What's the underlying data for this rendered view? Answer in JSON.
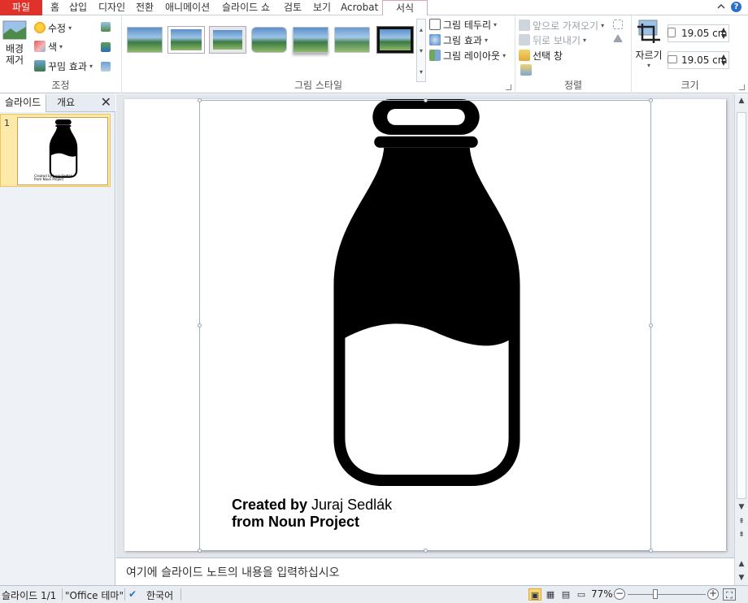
{
  "tabs": {
    "file": "파일",
    "home": "홈",
    "insert": "삽입",
    "design": "디자인",
    "transitions": "전환",
    "animations": "애니메이션",
    "slideshow": "슬라이드 쇼",
    "review": "검토",
    "view": "보기",
    "acrobat": "Acrobat",
    "format": "서식"
  },
  "ribbon": {
    "adjust": {
      "remove_bg_line1": "배경",
      "remove_bg_line2": "제거",
      "corrections": "수정",
      "color": "색",
      "artistic_effects": "꾸밈 효과",
      "label": "조정"
    },
    "picture_styles": {
      "border": "그림 테두리",
      "effects": "그림 효과",
      "layout": "그림 레이아웃",
      "label": "그림 스타일",
      "style_count": 7,
      "selected_style_index": 6
    },
    "arrange": {
      "bring_forward": "앞으로 가져오기",
      "send_backward": "뒤로 보내기",
      "selection_pane": "선택 창",
      "label": "정렬"
    },
    "size": {
      "crop": "자르기",
      "height": "19.05 cm",
      "width": "19.05 cm",
      "label": "크기"
    }
  },
  "left_panel": {
    "tab_slides": "슬라이드",
    "tab_outline": "개요",
    "close": "✕",
    "slide_number": "1"
  },
  "slide": {
    "credit_line1_bold": "Created by",
    "credit_line1_name": " Juraj Sedlák",
    "credit_line2": "from Noun Project"
  },
  "notes": {
    "placeholder": "여기에 슬라이드 노트의 내용을 입력하십시오"
  },
  "status_bar": {
    "slide_position": "슬라이드 1/1",
    "theme": "\"Office 테마\"",
    "language": "한국어",
    "zoom": "77%",
    "zoom_fraction": 0.77
  },
  "colors": {
    "file_tab": "#e0322b",
    "context_tab_accent": "#d9a6b6",
    "selected_slide_bg": "#fde9a9",
    "normal_view_highlight": "#fbd872"
  }
}
